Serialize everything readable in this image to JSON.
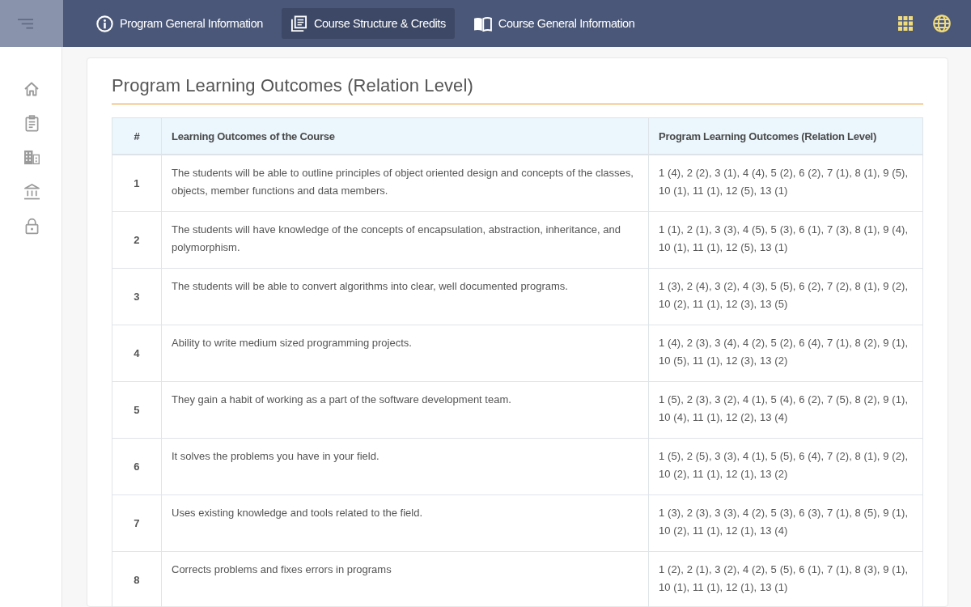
{
  "nav": {
    "tabs": [
      {
        "label": "Program General Information",
        "selected": false
      },
      {
        "label": "Course Structure & Credits",
        "selected": true
      },
      {
        "label": "Course General Information",
        "selected": false
      }
    ]
  },
  "section": {
    "title": "Program Learning Outcomes (Relation Level)"
  },
  "table": {
    "columns": [
      "#",
      "Learning Outcomes of the Course",
      "Program Learning Outcomes (Relation Level)"
    ],
    "rows": [
      {
        "number": "1",
        "outcome": "The students will be able to outline principles of object oriented design and concepts of the classes, objects, member functions and data members.",
        "relation": "1 (4), 2 (2), 3 (1), 4 (4), 5 (2), 6 (2), 7 (1), 8 (1), 9 (5), 10 (1), 11 (1), 12 (5), 13 (1)"
      },
      {
        "number": "2",
        "outcome": "The students will have knowledge of the concepts of encapsulation, abstraction, inheritance, and polymorphism.",
        "relation": "1 (1), 2 (1), 3 (3), 4 (5), 5 (3), 6 (1), 7 (3), 8 (1), 9 (4), 10 (1), 11 (1), 12 (5), 13 (1)"
      },
      {
        "number": "3",
        "outcome": "The students will be able to convert algorithms into clear, well documented programs.",
        "relation": "1 (3), 2 (4), 3 (2), 4 (3), 5 (5), 6 (2), 7 (2), 8 (1), 9 (2), 10 (2), 11 (1), 12 (3), 13 (5)"
      },
      {
        "number": "4",
        "outcome": "Ability to write medium sized programming projects.",
        "relation": "1 (4), 2 (3), 3 (4), 4 (2), 5 (2), 6 (4), 7 (1), 8 (2), 9 (1), 10 (5), 11 (1), 12 (3), 13 (2)"
      },
      {
        "number": "5",
        "outcome": "They gain a habit of working as a part of the software development team.",
        "relation": "1 (5), 2 (3), 3 (2), 4 (1), 5 (4), 6 (2), 7 (5), 8 (2), 9 (1), 10 (4), 11 (1), 12 (2), 13 (4)"
      },
      {
        "number": "6",
        "outcome": "It solves the problems you have in your field.",
        "relation": "1 (5), 2 (5), 3 (3), 4 (1), 5 (5), 6 (4), 7 (2), 8 (1), 9 (2), 10 (2), 11 (1), 12 (1), 13 (2)"
      },
      {
        "number": "7",
        "outcome": "Uses existing knowledge and tools related to the field.",
        "relation": "1 (3), 2 (3), 3 (3), 4 (2), 5 (3), 6 (3), 7 (1), 8 (5), 9 (1), 10 (2), 11 (1), 12 (1), 13 (4)"
      },
      {
        "number": "8",
        "outcome": "Corrects problems and fixes errors in programs",
        "relation": "1 (2), 2 (1), 3 (2), 4 (2), 5 (5), 6 (1), 7 (1), 8 (3), 9 (1), 10 (1), 11 (1), 12 (1), 13 (1)"
      }
    ]
  }
}
